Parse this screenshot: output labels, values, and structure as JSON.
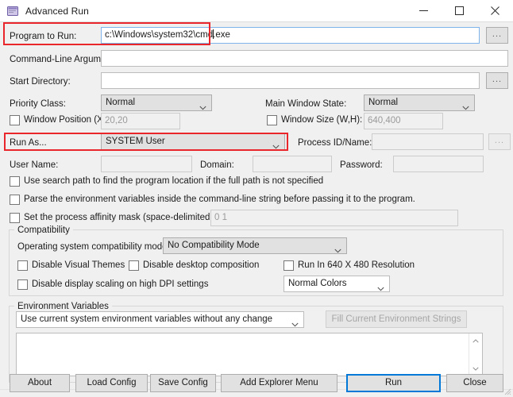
{
  "window": {
    "title": "Advanced Run",
    "icon": "app-window-icon",
    "minimize": "minimize-icon",
    "maximize": "maximize-icon",
    "close": "close-icon",
    "accent": "#0078d7",
    "highlight_color": "#e8262c"
  },
  "fields": {
    "program_to_run": {
      "label": "Program to Run:",
      "value_before_caret": "c:\\Windows\\system32\\cmd",
      "value_after_caret": ".exe",
      "full_value": "c:\\Windows\\system32\\cmd.exe",
      "browse": "..."
    },
    "command_line_arguments": {
      "label": "Command-Line Arguments:",
      "value": ""
    },
    "start_directory": {
      "label": "Start Directory:",
      "value": "",
      "browse": "..."
    }
  },
  "priority": {
    "label": "Priority Class:",
    "value": "Normal"
  },
  "main_window_state": {
    "label": "Main Window State:",
    "value": "Normal"
  },
  "window_position": {
    "label": "Window Position (X,Y):",
    "value": "20,20",
    "checked": false
  },
  "window_size": {
    "label": "Window Size (W,H):",
    "value": "640,400",
    "checked": false
  },
  "run_as": {
    "label": "Run As...",
    "value": "SYSTEM User"
  },
  "process_id": {
    "label": "Process ID/Name:",
    "value": "",
    "browse": "..."
  },
  "credentials": {
    "user_name_label": "User Name:",
    "user_name_value": "",
    "domain_label": "Domain:",
    "domain_value": "",
    "password_label": "Password:",
    "password_value": ""
  },
  "options": {
    "use_search_path": "Use search path to find the program location if the full path is not specified",
    "parse_env": "Parse the environment variables inside the command-line string before passing it to the program.",
    "affinity_mask": "Set the process affinity mask (space-delimited list):",
    "affinity_placeholder": "0 1"
  },
  "compatibility": {
    "group_title": "Compatibility",
    "os_mode_label": "Operating system compatibility mode:",
    "os_mode_value": "No Compatibility Mode",
    "disable_visual_themes": "Disable Visual Themes",
    "disable_desktop_composition": "Disable desktop composition",
    "run_640_480": "Run In 640 X 480 Resolution",
    "disable_dpi_scaling": "Disable display scaling on high DPI settings",
    "colors_value": "Normal Colors"
  },
  "environment": {
    "group_title": "Environment Variables",
    "mode_value": "Use current system environment variables without any change",
    "fill_button": "Fill Current Environment Strings",
    "textarea_value": "",
    "scroll_up": "scroll-up-icon",
    "scroll_down": "scroll-down-icon"
  },
  "footer": {
    "about": "About",
    "load_config": "Load Config",
    "save_config": "Save Config",
    "add_explorer_menu": "Add Explorer Menu",
    "run": "Run",
    "close": "Close"
  }
}
